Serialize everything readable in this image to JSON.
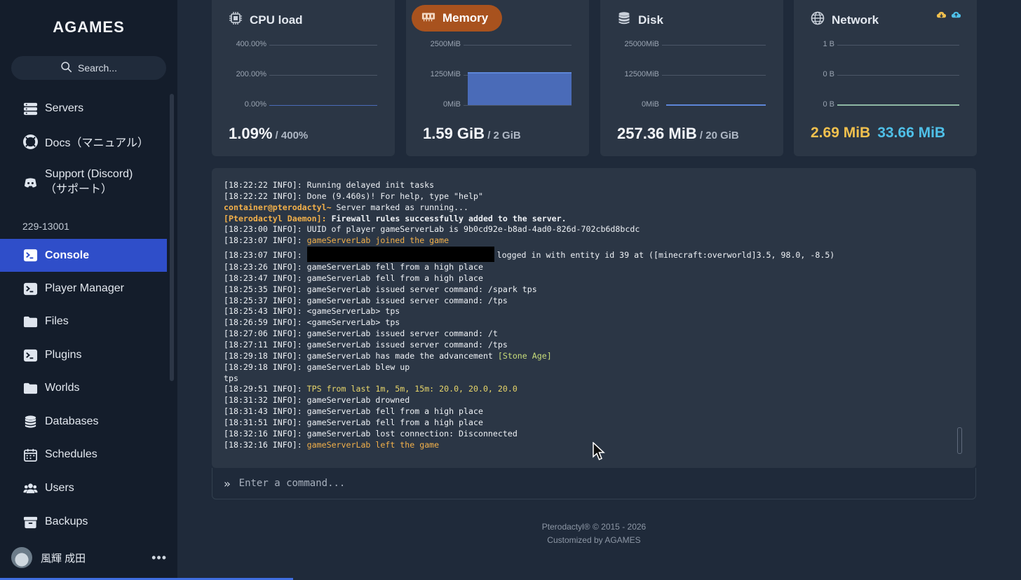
{
  "brand": "AGAMES",
  "search": {
    "label": "Search..."
  },
  "nav": {
    "servers": "Servers",
    "docs": "Docs（マニュアル）",
    "support_line1": "Support (Discord)",
    "support_line2": "（サポート）",
    "server_id": "229-13001",
    "console": "Console",
    "player_manager": "Player Manager",
    "files": "Files",
    "plugins": "Plugins",
    "worlds": "Worlds",
    "databases": "Databases",
    "schedules": "Schedules",
    "users": "Users",
    "backups": "Backups"
  },
  "user": {
    "name": "風輝 成田",
    "menu": "•••"
  },
  "cards": {
    "cpu": {
      "title": "CPU load",
      "ticks": [
        "400.00%",
        "200.00%",
        "0.00%"
      ],
      "value": "1.09%",
      "limit": " / 400%",
      "usage_fraction": 0.0027
    },
    "memory": {
      "title": "Memory",
      "ticks": [
        "2500MiB",
        "1250MiB",
        "0MiB"
      ],
      "value": "1.59 GiB",
      "limit": " / 2 GiB",
      "usage_fraction": 0.8
    },
    "disk": {
      "title": "Disk",
      "ticks": [
        "25000MiB",
        "12500MiB",
        "0MiB"
      ],
      "value": "257.36 MiB",
      "limit": " / 20 GiB"
    },
    "network": {
      "title": "Network",
      "ticks": [
        "1 B",
        "0 B",
        "0 B"
      ],
      "upload": "2.69 MiB",
      "download": "33.66 MiB"
    }
  },
  "colors": {
    "accent": "#2f4ec9",
    "memory_active": "#a8521e",
    "upload": "#f2c14e",
    "download": "#4fc0e8",
    "memory_fill": "#4a6bb8"
  },
  "console": {
    "lines": [
      [
        {
          "t": "[18:22:22 INFO]: Running delayed init tasks"
        }
      ],
      [
        {
          "t": "[18:22:22 INFO]: Done (9.460s)! For help, type \"help\""
        }
      ],
      [
        {
          "t": "container@pterodactyl~",
          "c": "c-orange c-bold"
        },
        {
          "t": " Server marked as running..."
        }
      ],
      [
        {
          "t": "[Pterodactyl Daemon]:",
          "c": "c-orange c-bold"
        },
        {
          "t": " Firewall rules successfully added to the server.",
          "c": "c-bold"
        }
      ],
      [
        {
          "t": "[18:23:00 INFO]: UUID of player gameServerLab is 9b0cd92e-b8ad-4ad0-826d-702cb6d8bcdc"
        }
      ],
      [
        {
          "t": "[18:23:07 INFO]: "
        },
        {
          "t": "gameServerLab joined the game",
          "c": "c-orange"
        }
      ],
      [
        {
          "t": "[18:23:07 INFO]: "
        },
        {
          "redact": true
        },
        {
          "t": " logged in with entity id 39 at ([minecraft:overworld]3.5, 98.0, -8.5)"
        }
      ],
      [
        {
          "t": "[18:23:26 INFO]: gameServerLab fell from a high place"
        }
      ],
      [
        {
          "t": "[18:23:47 INFO]: gameServerLab fell from a high place"
        }
      ],
      [
        {
          "t": "[18:25:35 INFO]: gameServerLab issued server command: /spark tps"
        }
      ],
      [
        {
          "t": "[18:25:37 INFO]: gameServerLab issued server command: /tps"
        }
      ],
      [
        {
          "t": "[18:25:43 INFO]: <gameServerLab> tps"
        }
      ],
      [
        {
          "t": "[18:26:59 INFO]: <gameServerLab> tps"
        }
      ],
      [
        {
          "t": "[18:27:06 INFO]: gameServerLab issued server command: /t"
        }
      ],
      [
        {
          "t": "[18:27:11 INFO]: gameServerLab issued server command: /tps"
        }
      ],
      [
        {
          "t": "[18:29:18 INFO]: gameServerLab has made the advancement "
        },
        {
          "t": "[Stone Age]",
          "c": "c-green"
        }
      ],
      [
        {
          "t": "[18:29:18 INFO]: gameServerLab blew up"
        }
      ],
      [
        {
          "t": "tps"
        }
      ],
      [
        {
          "t": "[18:29:51 INFO]: "
        },
        {
          "t": "TPS from last 1m, 5m, 15m: 20.0, 20.0, 20.0",
          "c": "c-yellow"
        }
      ],
      [
        {
          "t": "[18:31:32 INFO]: gameServerLab drowned"
        }
      ],
      [
        {
          "t": "[18:31:43 INFO]: gameServerLab fell from a high place"
        }
      ],
      [
        {
          "t": "[18:31:51 INFO]: gameServerLab fell from a high place"
        }
      ],
      [
        {
          "t": "[18:32:16 INFO]: gameServerLab lost connection: Disconnected"
        }
      ],
      [
        {
          "t": "[18:32:16 INFO]: "
        },
        {
          "t": "gameServerLab left the game",
          "c": "c-orange"
        }
      ]
    ],
    "command_placeholder": "Enter a command...",
    "prompt": "»"
  },
  "footer": {
    "line1": "Pterodactyl® © 2015 - 2026",
    "line2": "Customized by AGAMES"
  }
}
